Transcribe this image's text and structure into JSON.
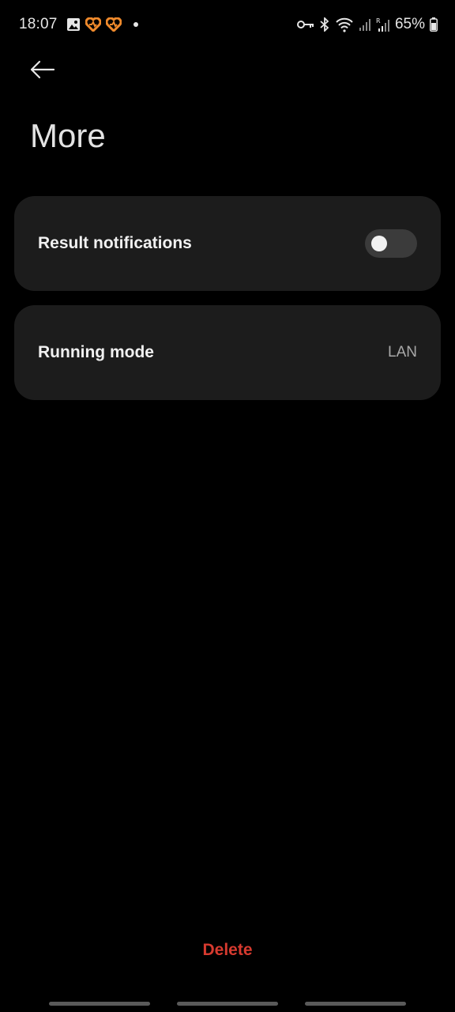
{
  "status_bar": {
    "time": "18:07",
    "battery_percent": "65%",
    "left_icons": [
      "gallery-icon",
      "health-heart-icon",
      "health-heart-icon",
      "notification-dot-icon"
    ],
    "right_icons": [
      "vpn-key-icon",
      "bluetooth-icon",
      "wifi-icon",
      "signal-icon",
      "roaming-signal-icon",
      "battery-icon"
    ],
    "accent_orange": "#f08a2c"
  },
  "header": {
    "back_icon": "arrow-left-icon",
    "title": "More"
  },
  "settings": {
    "notifications": {
      "label": "Result notifications",
      "enabled": false
    },
    "running_mode": {
      "label": "Running mode",
      "value": "LAN"
    }
  },
  "footer": {
    "delete_label": "Delete",
    "delete_color": "#d63a2f"
  }
}
